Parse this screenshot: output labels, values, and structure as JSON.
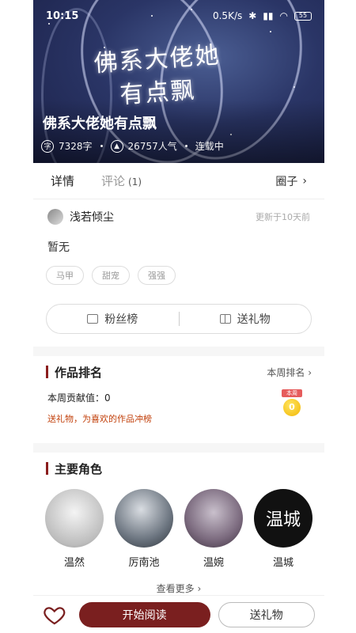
{
  "status_bar": {
    "time": "10:15",
    "network": "0.5K/s",
    "battery": "55"
  },
  "hero": {
    "art_title_line1": "佛系大佬她",
    "art_title_line2": "有点飘",
    "title": "佛系大佬她有点飘",
    "word_count": "7328字",
    "popularity": "26757人气",
    "serial_status": "连载中"
  },
  "tabs": {
    "details": "详情",
    "comments": "评论",
    "comments_count": "(1)",
    "circle": "圈子"
  },
  "author": {
    "name": "浅若倾尘",
    "updated": "更新于10天前"
  },
  "intro": "暂无",
  "tags": [
    "马甲",
    "甜宠",
    "强强"
  ],
  "actions": {
    "fans_rank": "粉丝榜",
    "send_gift": "送礼物"
  },
  "ranking": {
    "title": "作品排名",
    "weekly_link": "本周排名",
    "weekly_contrib": "本周贡献值：0",
    "tip": "送礼物，为喜欢的作品冲榜",
    "medal_label": "本周",
    "medal_value": "0"
  },
  "characters": {
    "title": "主要角色",
    "items": [
      {
        "name": "温然"
      },
      {
        "name": "厉南池"
      },
      {
        "name": "温婉"
      },
      {
        "name": "温城",
        "avatar_text": "温城"
      }
    ],
    "see_more": "查看更多"
  },
  "bottom": {
    "start_reading": "开始阅读",
    "send_gift": "送礼物"
  },
  "colors": {
    "accent": "#7a1f1f",
    "section_bar": "#8b1d1d",
    "tip": "#c2410c"
  }
}
